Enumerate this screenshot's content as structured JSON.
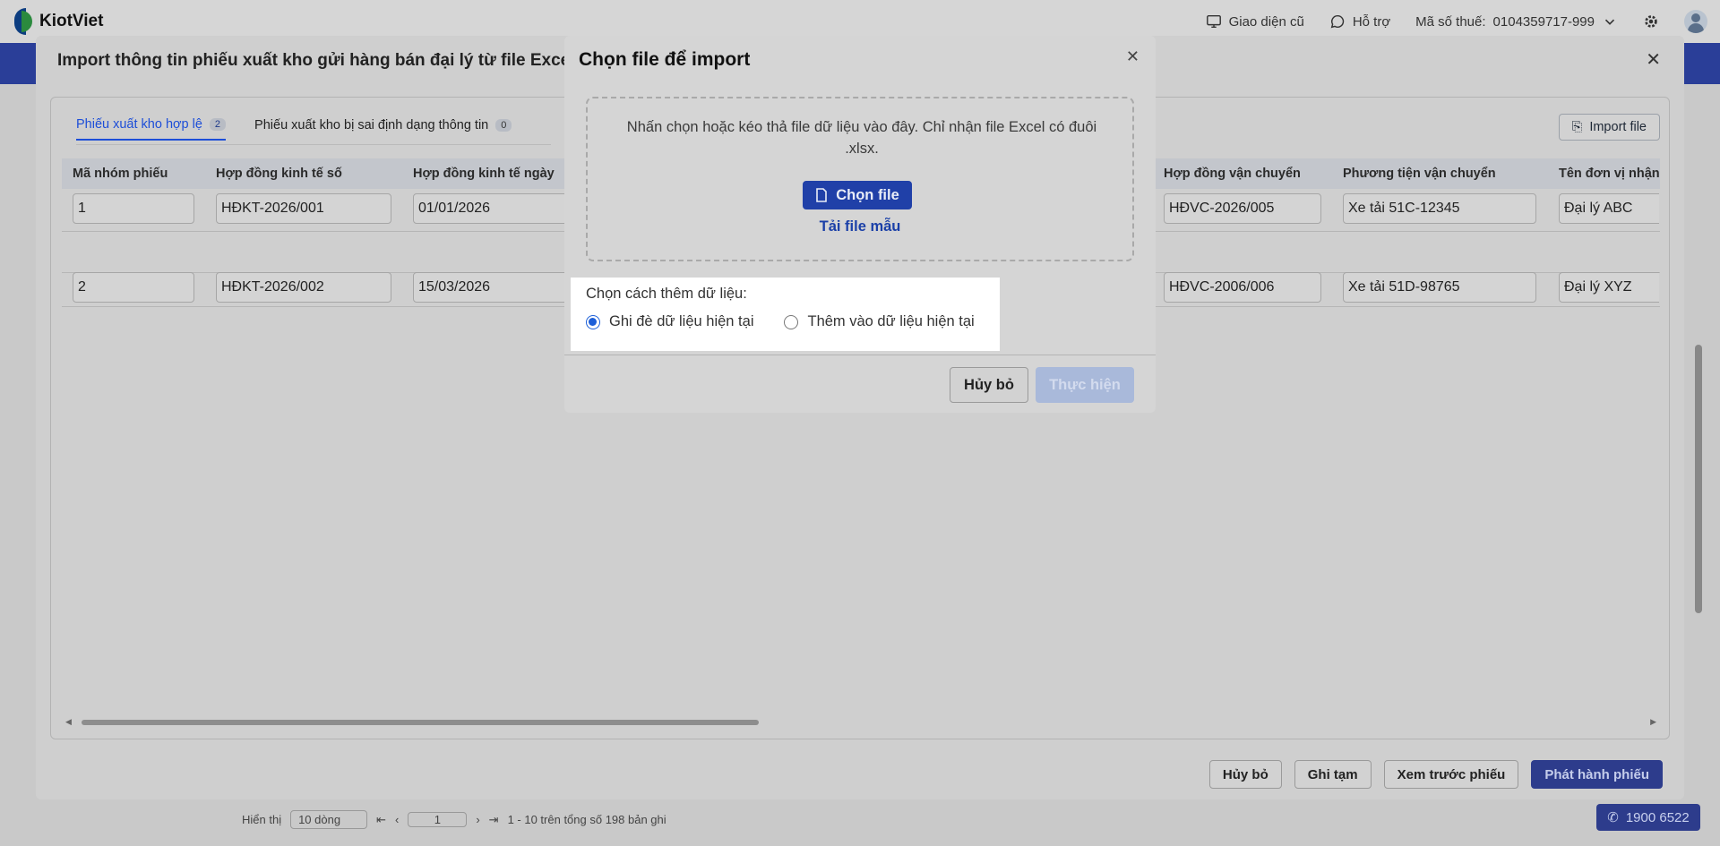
{
  "app": {
    "logo_text": "KiotViet",
    "top_links": {
      "old_ui": "Giao diện cũ",
      "support": "Hỗ trợ",
      "tax_label": "Mã số thuế:",
      "tax_value": "0104359717-999"
    },
    "hotline": "1900 6522",
    "footer": {
      "show_label": "Hiển thị",
      "page_size": "10 dòng",
      "page": "1",
      "summary": "1 - 10 trên tổng số 198 bản ghi"
    }
  },
  "import_modal": {
    "title": "Import thông tin phiếu xuất kho gửi hàng bán đại lý từ file Excel",
    "tabs": [
      {
        "label": "Phiếu xuất kho hợp lệ",
        "count": "2"
      },
      {
        "label": "Phiếu xuất kho bị sai định dạng thông tin",
        "count": "0"
      }
    ],
    "import_button": "Import file",
    "columns": [
      "Mã nhóm phiếu",
      "Hợp đồng kinh tế số",
      "Hợp đồng kinh tế ngày",
      "Hợp đồng vận chuyển",
      "Phương tiện vận chuyển",
      "Tên đơn vị nhận"
    ],
    "rows": [
      [
        "1",
        "HĐKT-2026/001",
        "01/01/2026",
        "HĐVC-2026/005",
        "Xe tải 51C-12345",
        "Đại lý ABC"
      ],
      [
        "2",
        "HĐKT-2026/002",
        "15/03/2026",
        "HĐVC-2006/006",
        "Xe tải 51D-98765",
        "Đại lý XYZ"
      ]
    ],
    "footer_buttons": {
      "cancel": "Hủy bỏ",
      "draft": "Ghi tạm",
      "preview": "Xem trước phiếu",
      "issue": "Phát hành phiếu"
    }
  },
  "dialog": {
    "title": "Chọn file để import",
    "dropzone_text": "Nhấn chọn hoặc kéo thả file dữ liệu vào đây. Chỉ nhận file Excel có đuôi .xlsx.",
    "choose_file": "Chọn file",
    "template_link": "Tải file mẫu",
    "mode_label": "Chọn cách thêm dữ liệu:",
    "options": [
      {
        "label": "Ghi đè dữ liệu hiện tại",
        "selected": true
      },
      {
        "label": "Thêm vào dữ liệu hiện tại",
        "selected": false
      }
    ],
    "cancel": "Hủy bỏ",
    "submit": "Thực hiện"
  }
}
